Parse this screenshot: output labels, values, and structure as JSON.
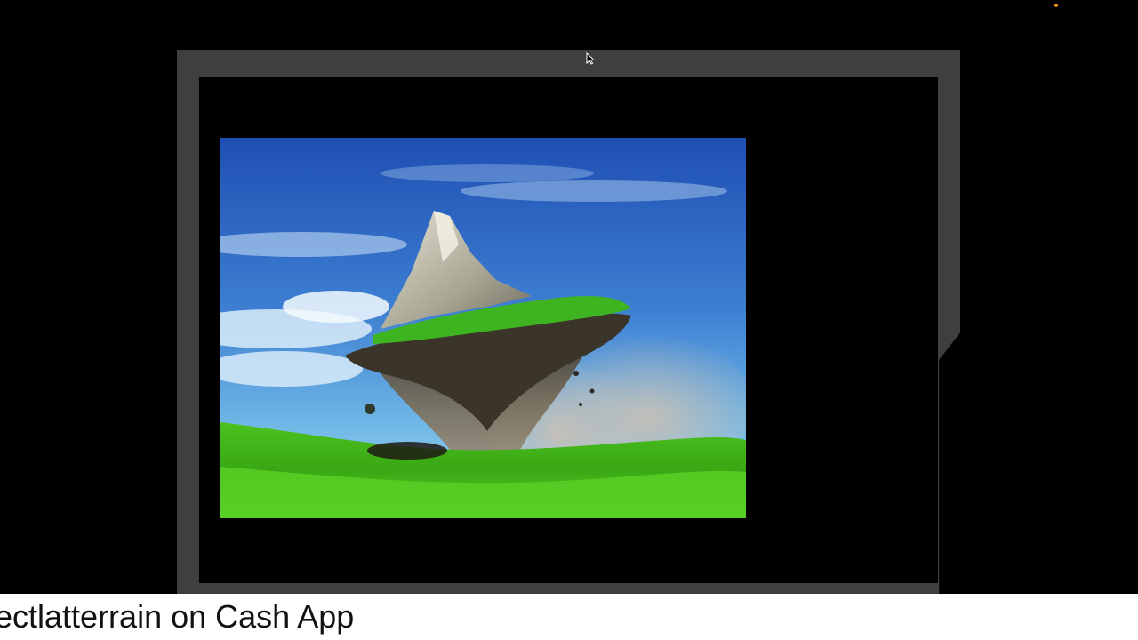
{
  "colors": {
    "background": "#000000",
    "frame": "#3f3f3f",
    "ticker_bg": "#ffffff",
    "ticker_text": "#111111",
    "indicator": "#e08a1c"
  },
  "ticker": {
    "text": "ectlatterrain on Cash App"
  },
  "icons": {
    "cursor": "mouse-pointer-icon",
    "indicator": "recording-dot-icon"
  }
}
